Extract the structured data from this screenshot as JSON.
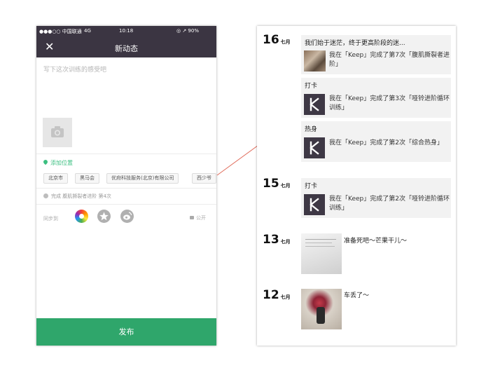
{
  "compose": {
    "status": {
      "carrier": "●●●○○ 中国联通",
      "network": "4G",
      "time": "10:18",
      "battery": "◎ ↗ 90%"
    },
    "close_icon": "✕",
    "title": "新动态",
    "placeholder": "写下这次训练的感受吧",
    "add_location": "添加位置",
    "location_tags": [
      "北京市",
      "黑马会",
      "优府科技服务(北京)有限公司",
      "西少爷"
    ],
    "completed": "完成 腹肌撕裂者进阶 第4次",
    "sync_label": "同步到",
    "share_icons": [
      "moments-icon",
      "star-icon",
      "weibo-icon"
    ],
    "privacy": "公开",
    "publish": "发布"
  },
  "feed": {
    "days": [
      {
        "day": "16",
        "month": "七月"
      },
      {
        "day": "15",
        "month": "七月"
      },
      {
        "day": "13",
        "month": "七月"
      },
      {
        "day": "12",
        "month": "七月"
      }
    ],
    "cards": [
      {
        "title": "我们始于迷茫，终于更高阶段的迷...",
        "text": "我在「Keep」完成了第7次「腹肌撕裂者进阶」",
        "icon": "workout-photo"
      },
      {
        "title": "打卡",
        "text": "我在「Keep」完成了第3次「哑铃进阶循环训练」",
        "icon": "keep-logo-icon"
      },
      {
        "title": "热身",
        "text": "我在「Keep」完成了第2次「综合热身」",
        "icon": "keep-logo-icon"
      },
      {
        "title": "打卡",
        "text": "我在「Keep」完成了第2次「哑铃进阶循环训练」",
        "icon": "keep-logo-icon"
      }
    ],
    "photo_posts": [
      {
        "text": "准备死吧～芒果干儿～"
      },
      {
        "text": "车丢了～"
      }
    ]
  },
  "colors": {
    "dark_bar": "#3b3542",
    "green": "#2fa66b",
    "location_green": "#3bbf80",
    "arrow": "#e06b5a"
  }
}
